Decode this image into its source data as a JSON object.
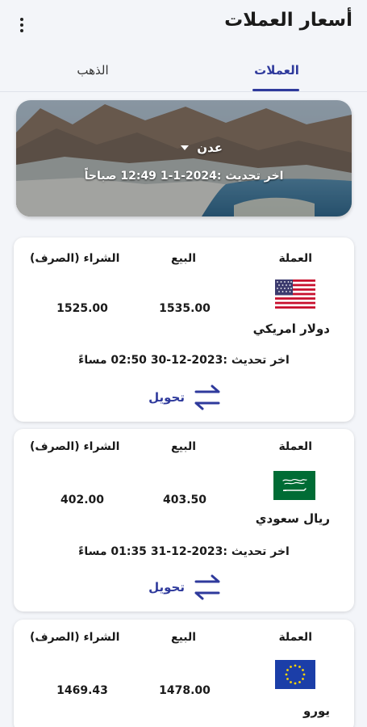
{
  "appbar": {
    "title": "أسعار العملات",
    "menu_icon": "more-vert-icon"
  },
  "tabs": [
    {
      "label": "العملات",
      "selected": true
    },
    {
      "label": "الذهب",
      "selected": false
    }
  ],
  "banner": {
    "region": "عدن",
    "last_update": "اخر تحديث :2024-1-1 12:49 صباحاً"
  },
  "columns": {
    "currency": "العملة",
    "sell": "البيع",
    "buy": "الشراء (الصرف)"
  },
  "convert_label": "تحويل",
  "colors": {
    "accent": "#2f3a9c",
    "background": "#f3f5f9",
    "card": "#ffffff"
  },
  "currencies": [
    {
      "name": "دولار امريكي",
      "flag": "us-flag-icon",
      "sell": "1535.00",
      "buy": "1525.00",
      "updated": "اخر تحديث :2023-12-30 02:50 مساءً"
    },
    {
      "name": "ريال سعودي",
      "flag": "saudi-flag-icon",
      "sell": "403.50",
      "buy": "402.00",
      "updated": "اخر تحديث :2023-12-31 01:35 مساءً"
    },
    {
      "name": "يورو",
      "flag": "eu-flag-icon",
      "sell": "1478.00",
      "buy": "1469.43"
    }
  ]
}
